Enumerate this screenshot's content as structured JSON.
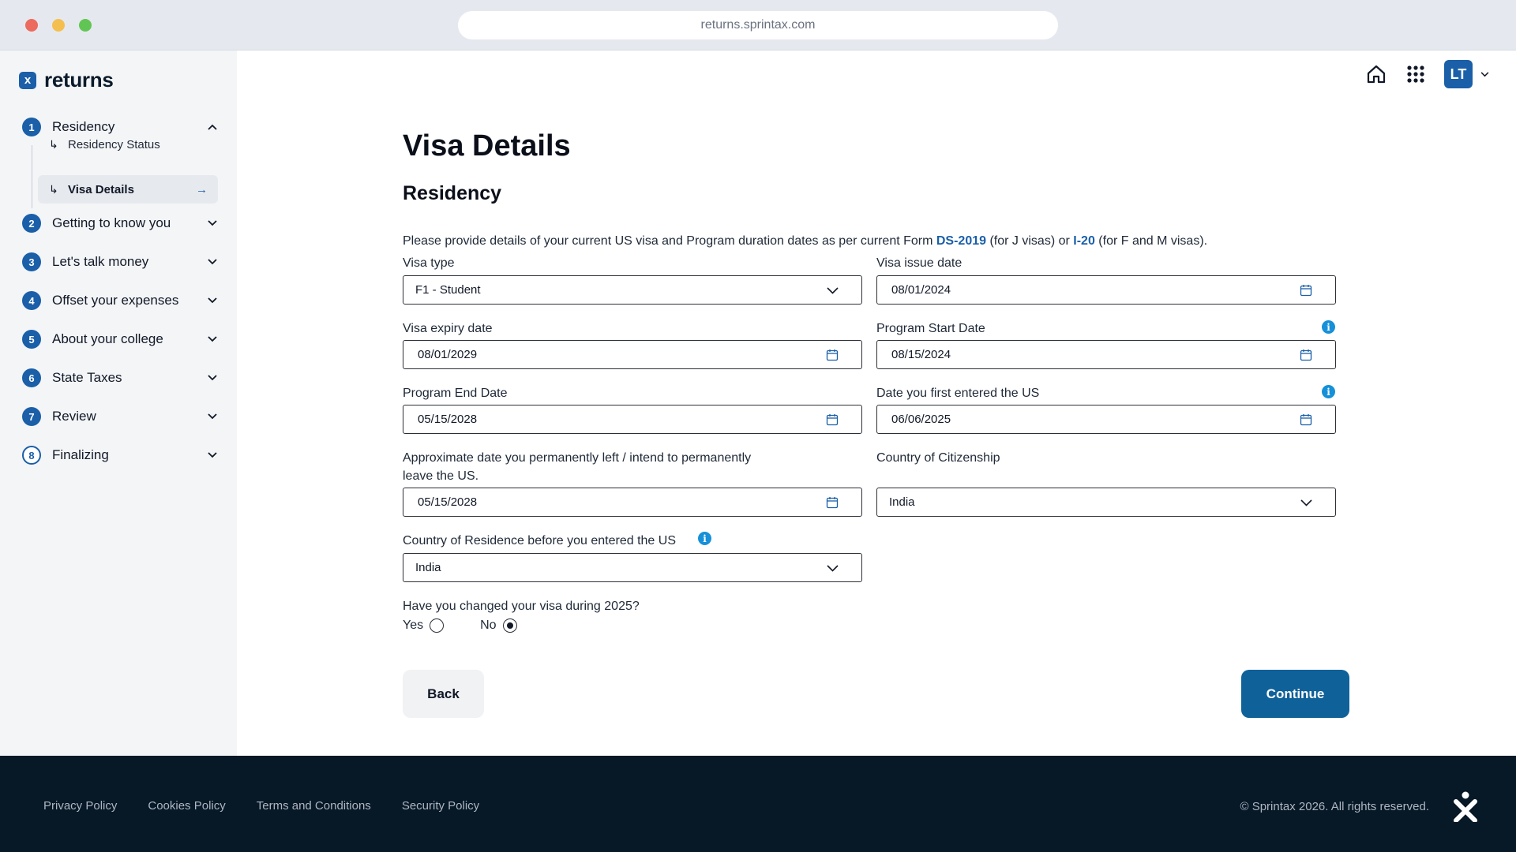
{
  "browser": {
    "url": "returns.sprintax.com"
  },
  "brand": {
    "logo_glyph": "x",
    "name": "returns"
  },
  "sidebar": {
    "steps": [
      {
        "num": "1",
        "label": "Residency",
        "expanded": true
      },
      {
        "num": "2",
        "label": "Getting to know you"
      },
      {
        "num": "3",
        "label": "Let's talk money"
      },
      {
        "num": "4",
        "label": "Offset your expenses"
      },
      {
        "num": "5",
        "label": "About your college"
      },
      {
        "num": "6",
        "label": "State Taxes"
      },
      {
        "num": "7",
        "label": "Review"
      },
      {
        "num": "8",
        "label": "Finalizing"
      }
    ],
    "substeps": [
      {
        "label": "Residency Status"
      },
      {
        "label": "Visa Details",
        "active": true
      }
    ]
  },
  "header": {
    "avatar_initials": "LT"
  },
  "main": {
    "title": "Visa Details",
    "section": "Residency",
    "intro": {
      "before": "Please provide details of your current US visa and Program duration dates as per current Form ",
      "link1": "DS-2019",
      "middle": " (for J visas) or ",
      "link2": "I-20",
      "after": " (for F and M visas)."
    },
    "fields": {
      "visa_type": {
        "label": "Visa type",
        "value": "F1 - Student"
      },
      "visa_issue_date": {
        "label": "Visa issue date",
        "value": "08/01/2024"
      },
      "visa_expiry_date": {
        "label": "Visa expiry date",
        "value": "08/01/2029"
      },
      "program_start_date": {
        "label": "Program Start Date",
        "value": "08/15/2024"
      },
      "program_end_date": {
        "label": "Program End Date",
        "value": "05/15/2028"
      },
      "first_entered_date": {
        "label": "Date you first entered the US",
        "value": "06/06/2025"
      },
      "left_us_date": {
        "label_line1": "Approximate date you permanently left / intend to permanently",
        "label_line2": "leave the US.",
        "value": "05/15/2028"
      },
      "country_citizenship": {
        "label": "Country of Citizenship",
        "value": "India"
      },
      "country_residence": {
        "label": "Country of Residence before you entered the US",
        "value": "India"
      }
    },
    "visa_changed": {
      "question": "Have you changed your visa during 2025?",
      "options": [
        "Yes",
        "No"
      ],
      "selected": "No"
    },
    "buttons": {
      "back": "Back",
      "continue": "Continue"
    }
  },
  "footer": {
    "links": [
      "Privacy Policy",
      "Cookies Policy",
      "Terms and Conditions",
      "Security Policy"
    ],
    "copyright": "© Sprintax 2026. All rights reserved."
  },
  "colors": {
    "brand": "#1a5fa8",
    "primary_button": "#0f6199",
    "info": "#1690d8",
    "footer_bg": "#071826"
  },
  "icons": [
    "home-icon",
    "apps-grid-icon",
    "chevron-down-icon",
    "calendar-icon",
    "info-icon",
    "arrow-right-icon"
  ]
}
